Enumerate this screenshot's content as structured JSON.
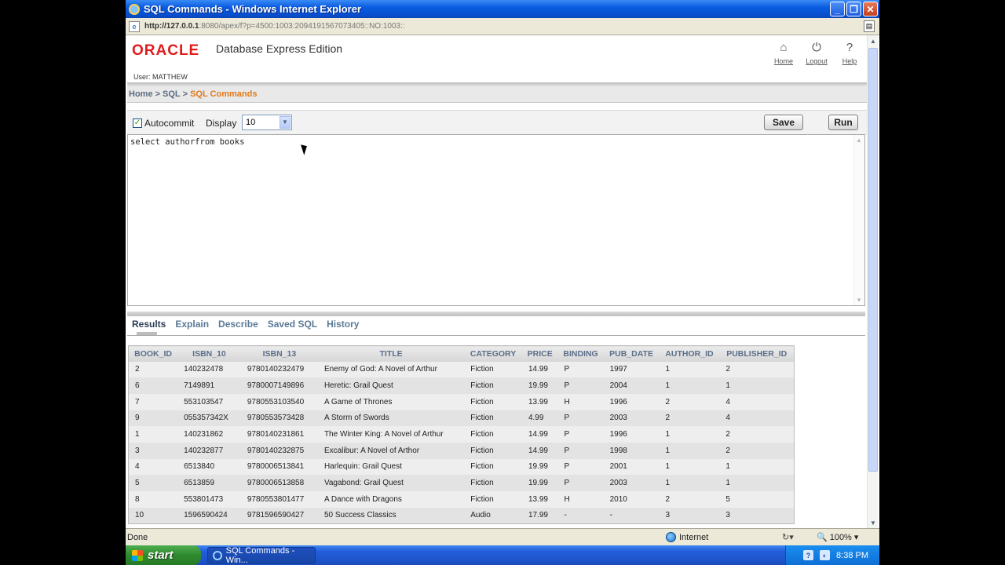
{
  "window": {
    "title": "SQL Commands - Windows Internet Explorer",
    "minimize": "_",
    "maximize": "❐",
    "close": "✕"
  },
  "address": {
    "host": "http://127.0.0.1",
    "path": ":8080/apex/f?p=4500:1003:2094191567073405::NO:1003::"
  },
  "header": {
    "logo": "ORACLE",
    "product": "Database Express Edition",
    "user": "User: MATTHEW",
    "links": [
      {
        "label": "Home",
        "icon": "home-icon"
      },
      {
        "label": "Logout",
        "icon": "power-icon"
      },
      {
        "label": "Help",
        "icon": "help-icon"
      }
    ]
  },
  "breadcrumb": {
    "items": [
      "Home",
      "SQL"
    ],
    "separator": ">",
    "current": "SQL Commands"
  },
  "toolbar": {
    "autocommit_label": "Autocommit",
    "autocommit_checked": true,
    "display_label": "Display",
    "display_value": "10",
    "save_label": "Save",
    "run_label": "Run"
  },
  "editor": {
    "sql": "select authorfrom books"
  },
  "tabs": [
    "Results",
    "Explain",
    "Describe",
    "Saved SQL",
    "History"
  ],
  "results": {
    "columns": [
      "BOOK_ID",
      "ISBN_10",
      "ISBN_13",
      "TITLE",
      "CATEGORY",
      "PRICE",
      "BINDING",
      "PUB_DATE",
      "AUTHOR_ID",
      "PUBLISHER_ID"
    ],
    "rows": [
      [
        "2",
        "140232478",
        "9780140232479",
        "Enemy of God: A Novel of Arthur",
        "Fiction",
        "14.99",
        "P",
        "1997",
        "1",
        "2"
      ],
      [
        "6",
        "7149891",
        "9780007149896",
        "Heretic: Grail Quest",
        "Fiction",
        "19.99",
        "P",
        "2004",
        "1",
        "1"
      ],
      [
        "7",
        "553103547",
        "9780553103540",
        "A Game of Thrones",
        "Fiction",
        "13.99",
        "H",
        "1996",
        "2",
        "4"
      ],
      [
        "9",
        "055357342X",
        "9780553573428",
        "A Storm of Swords",
        "Fiction",
        "4.99",
        "P",
        "2003",
        "2",
        "4"
      ],
      [
        "1",
        "140231862",
        "9780140231861",
        "The Winter King: A Novel of Arthur",
        "Fiction",
        "14.99",
        "P",
        "1996",
        "1",
        "2"
      ],
      [
        "3",
        "140232877",
        "9780140232875",
        "Excalibur: A Novel of Arthor",
        "Fiction",
        "14.99",
        "P",
        "1998",
        "1",
        "2"
      ],
      [
        "4",
        "6513840",
        "9780006513841",
        "Harlequin: Grail Quest",
        "Fiction",
        "19.99",
        "P",
        "2001",
        "1",
        "1"
      ],
      [
        "5",
        "6513859",
        "9780006513858",
        "Vagabond: Grail Quest",
        "Fiction",
        "19.99",
        "P",
        "2003",
        "1",
        "1"
      ],
      [
        "8",
        "553801473",
        "9780553801477",
        "A Dance with Dragons",
        "Fiction",
        "13.99",
        "H",
        "2010",
        "2",
        "5"
      ],
      [
        "10",
        "1596590424",
        "9781596590427",
        "50 Success Classics",
        "Audio",
        "17.99",
        "-",
        "-",
        "3",
        "3"
      ]
    ]
  },
  "status": {
    "text": "Done",
    "zone": "Internet",
    "zoom": "100%"
  },
  "taskbar": {
    "start": "start",
    "item": "SQL Commands - Win...",
    "clock": "8:38 PM"
  }
}
